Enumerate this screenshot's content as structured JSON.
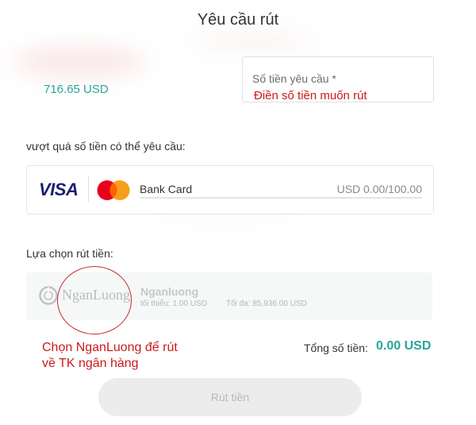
{
  "page": {
    "title": "Yêu cầu rút"
  },
  "balance": {
    "value": "716.65 USD"
  },
  "amount": {
    "label": "Số tiền yêu cầu *",
    "value": "",
    "note": "Điền số tiền muốn rút"
  },
  "exceed": {
    "label": "vượt quá số tiền có thể yêu cầu:"
  },
  "card_method": {
    "visa_text": "VISA",
    "name": "Bank Card",
    "limit": "USD 0.00/100.00"
  },
  "withdraw_method": {
    "label": "Lựa chọn rút tiền:",
    "logo_text": "NganLuong",
    "name": "Nganluong",
    "min": "tối thiểu: 1.00 USD",
    "max": "Tối đa: 85,936.00 USD",
    "note": "Chọn NganLuong để rút về TK ngân hàng"
  },
  "total": {
    "label": "Tổng số tiền:",
    "value": "0.00 USD"
  },
  "submit": {
    "label": "Rút tiền"
  },
  "colors": {
    "accent": "#26a69a",
    "annotation": "#cc1a1a",
    "visa": "#1a1f71",
    "mc_red": "#eb001b",
    "mc_orange": "#f79e1b"
  }
}
